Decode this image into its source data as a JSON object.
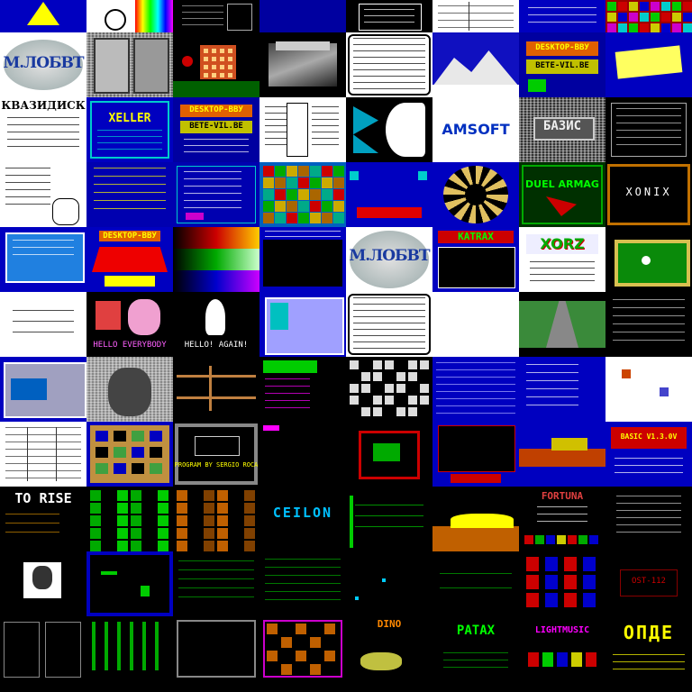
{
  "colors": {
    "blue": "#0000c0",
    "deep_blue": "#000090",
    "black": "#000000",
    "white": "#ffffff",
    "yellow": "#ffff00",
    "cyan": "#00c0c0",
    "green": "#00c000",
    "red": "#c00000",
    "magenta": "#c000c0",
    "orange": "#d08000",
    "gray": "#808080"
  },
  "tiles": {
    "mlobbt_logo": "М.ЛОБВТ",
    "kvazidisk": "КВАЗИДИСК",
    "xeller": "XELLER",
    "desktop_a_title": "DESKTOP-ВВУ",
    "desktop_a_sub": "ВЕТЕ-VIL.ВЕ",
    "amsoft": "AMSOFT",
    "bazis": "БАЗИС",
    "desktop_b_title": "DESKTOP-ВВУ",
    "desktop_b_sub": "ВЕТЕ-VIL.ВЕ",
    "duel_armag": "DUEL ARMAG",
    "xonix": "XONIX",
    "desktop_c_title": "DESKTOP-ВВУ",
    "mlobbt_logo_2": "М.ЛОБВТ",
    "katrax": "KATRAX",
    "xorz": "XORZ",
    "hello_everybody": "HELLO EVERYBODY",
    "hello_again": "HELLO! AGAIN!",
    "program_by": "PROGRAM BY SERGIO ROCA",
    "basic_ver": "BASIC V1.3.0V",
    "to_rise": "TO RISE",
    "ceilon": "CEILON",
    "fortuna": "FORTUNA",
    "dino": "DINO",
    "patax": "PATAX",
    "lightmusic": "LIGHTMUSIC",
    "opde": "ОПДЕ",
    "ost": "OST-112"
  }
}
